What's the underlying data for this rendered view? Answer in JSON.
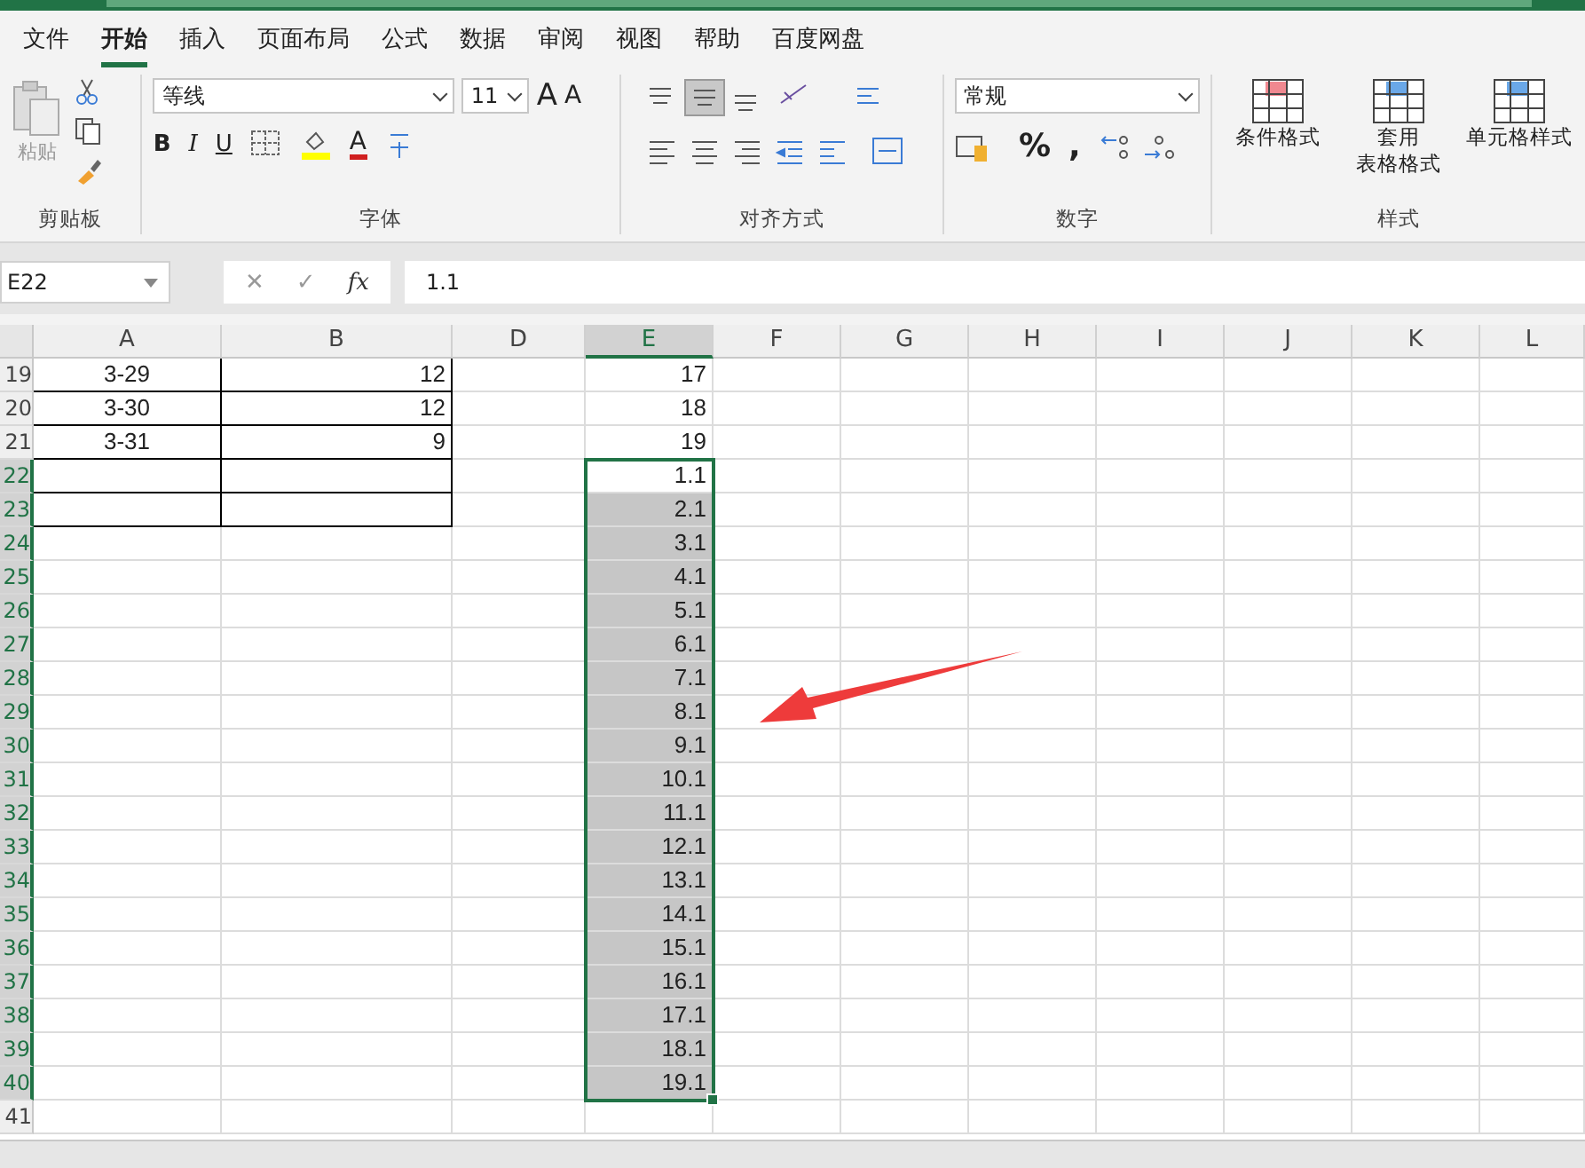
{
  "tabs": [
    {
      "label": "文件",
      "selected": false
    },
    {
      "label": "开始",
      "selected": true
    },
    {
      "label": "插入",
      "selected": false
    },
    {
      "label": "页面布局",
      "selected": false
    },
    {
      "label": "公式",
      "selected": false
    },
    {
      "label": "数据",
      "selected": false
    },
    {
      "label": "审阅",
      "selected": false
    },
    {
      "label": "视图",
      "selected": false
    },
    {
      "label": "帮助",
      "selected": false
    },
    {
      "label": "百度网盘",
      "selected": false
    }
  ],
  "ribbon": {
    "clipboard": {
      "paste": "粘贴",
      "label": "剪贴板"
    },
    "font": {
      "family": "等线",
      "size": "11",
      "grow": "A",
      "shrink": "A",
      "bold": "B",
      "italic": "I",
      "underline": "U",
      "color_letter": "A",
      "label": "字体"
    },
    "alignment": {
      "label": "对齐方式"
    },
    "number": {
      "format": "常规",
      "percent": "%",
      "comma": ",",
      "label": "数字"
    },
    "styles": {
      "items": [
        {
          "lines": [
            "条件格式"
          ]
        },
        {
          "lines": [
            "套用",
            "表格格式"
          ]
        },
        {
          "lines": [
            "单元格样式"
          ]
        }
      ],
      "label": "样式"
    }
  },
  "name_box": "E22",
  "formula_buttons": [
    "✕",
    "✓",
    "fx"
  ],
  "formula": "1.1",
  "columns": [
    {
      "label": "A",
      "selected": false
    },
    {
      "label": "B",
      "selected": false
    },
    {
      "label": "D",
      "selected": false
    },
    {
      "label": "E",
      "selected": true
    },
    {
      "label": "F",
      "selected": false
    },
    {
      "label": "G",
      "selected": false
    },
    {
      "label": "H",
      "selected": false
    },
    {
      "label": "I",
      "selected": false
    },
    {
      "label": "J",
      "selected": false
    },
    {
      "label": "K",
      "selected": false
    },
    {
      "label": "L",
      "selected": false
    }
  ],
  "rows": [
    {
      "number": "19",
      "selected": false,
      "bordered": true,
      "a": "3-29",
      "b": "12",
      "e": "17"
    },
    {
      "number": "20",
      "selected": false,
      "bordered": true,
      "a": "3-30",
      "b": "12",
      "e": "18"
    },
    {
      "number": "21",
      "selected": false,
      "bordered": true,
      "a": "3-31",
      "b": "9",
      "e": "19"
    },
    {
      "number": "22",
      "selected": true,
      "bordered": true,
      "a": "",
      "b": "",
      "e": "1.1"
    },
    {
      "number": "23",
      "selected": true,
      "bordered": true,
      "a": "",
      "b": "",
      "e": "2.1"
    },
    {
      "number": "24",
      "selected": true,
      "bordered": false,
      "a": "",
      "b": "",
      "e": "3.1"
    },
    {
      "number": "25",
      "selected": true,
      "bordered": false,
      "a": "",
      "b": "",
      "e": "4.1"
    },
    {
      "number": "26",
      "selected": true,
      "bordered": false,
      "a": "",
      "b": "",
      "e": "5.1"
    },
    {
      "number": "27",
      "selected": true,
      "bordered": false,
      "a": "",
      "b": "",
      "e": "6.1"
    },
    {
      "number": "28",
      "selected": true,
      "bordered": false,
      "a": "",
      "b": "",
      "e": "7.1"
    },
    {
      "number": "29",
      "selected": true,
      "bordered": false,
      "a": "",
      "b": "",
      "e": "8.1"
    },
    {
      "number": "30",
      "selected": true,
      "bordered": false,
      "a": "",
      "b": "",
      "e": "9.1"
    },
    {
      "number": "31",
      "selected": true,
      "bordered": false,
      "a": "",
      "b": "",
      "e": "10.1"
    },
    {
      "number": "32",
      "selected": true,
      "bordered": false,
      "a": "",
      "b": "",
      "e": "11.1"
    },
    {
      "number": "33",
      "selected": true,
      "bordered": false,
      "a": "",
      "b": "",
      "e": "12.1"
    },
    {
      "number": "34",
      "selected": true,
      "bordered": false,
      "a": "",
      "b": "",
      "e": "13.1"
    },
    {
      "number": "35",
      "selected": true,
      "bordered": false,
      "a": "",
      "b": "",
      "e": "14.1"
    },
    {
      "number": "36",
      "selected": true,
      "bordered": false,
      "a": "",
      "b": "",
      "e": "15.1"
    },
    {
      "number": "37",
      "selected": true,
      "bordered": false,
      "a": "",
      "b": "",
      "e": "16.1"
    },
    {
      "number": "38",
      "selected": true,
      "bordered": false,
      "a": "",
      "b": "",
      "e": "17.1"
    },
    {
      "number": "39",
      "selected": true,
      "bordered": false,
      "a": "",
      "b": "",
      "e": "18.1"
    },
    {
      "number": "40",
      "selected": true,
      "bordered": false,
      "a": "",
      "b": "",
      "e": "19.1"
    },
    {
      "number": "41",
      "selected": false,
      "bordered": false,
      "a": "",
      "b": "",
      "e": ""
    }
  ]
}
